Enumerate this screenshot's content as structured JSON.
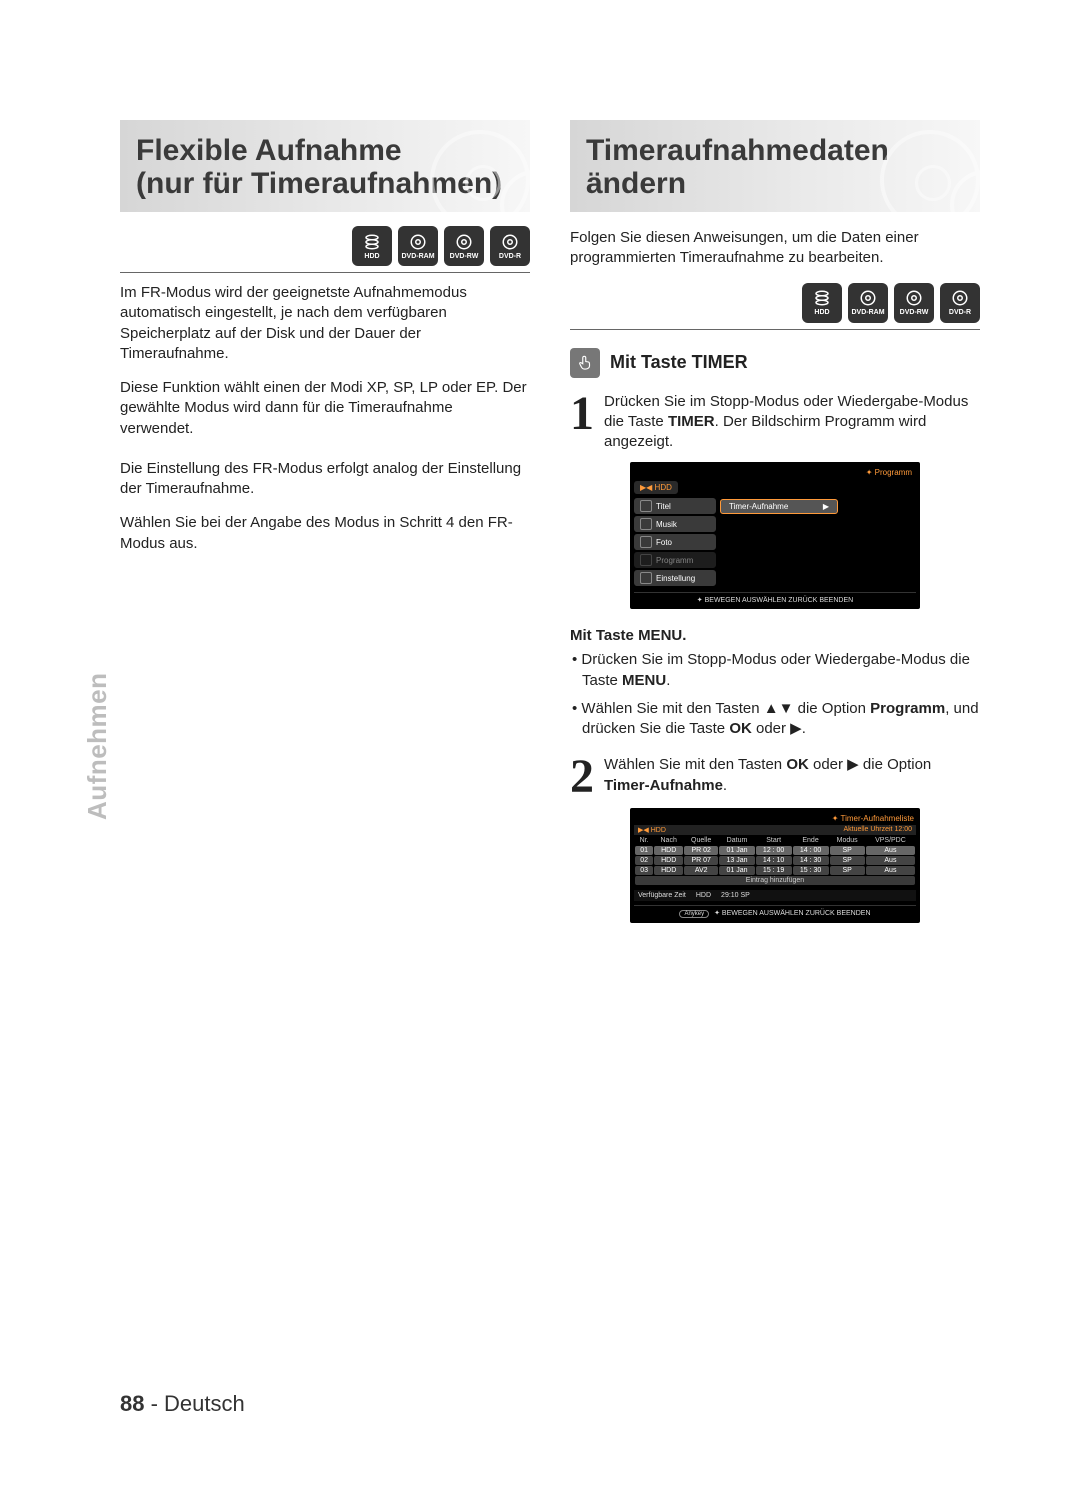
{
  "section_tab": "Aufnehmen",
  "footer": {
    "page": "88",
    "sep": " - ",
    "lang": "Deutsch"
  },
  "left": {
    "heading_l1": "Flexible Aufnahme",
    "heading_l2": "(nur für Timeraufnahmen)",
    "icons": [
      "HDD",
      "DVD-RAM",
      "DVD-RW",
      "DVD-R"
    ],
    "para1": "Im FR-Modus wird der geeignetste Aufnahmemodus automatisch eingestellt, je nach dem verfügbaren Speicherplatz auf der Disk und der Dauer der Timeraufnahme.",
    "para2": "Diese Funktion wählt einen der Modi XP, SP, LP oder EP. Der gewählte Modus wird dann für die Timeraufnahme verwendet.",
    "para3": "Die Einstellung des FR-Modus erfolgt analog der Einstellung der Timeraufnahme.",
    "para4": "Wählen Sie bei der Angabe des Modus in Schritt 4 den FR-Modus aus."
  },
  "right": {
    "heading_l1": "Timeraufnahmedaten",
    "heading_l2": "ändern",
    "intro": "Folgen Sie diesen Anweisungen, um die  Daten einer programmierten Timeraufnahme zu bearbeiten.",
    "icons": [
      "HDD",
      "DVD-RAM",
      "DVD-RW",
      "DVD-R"
    ],
    "subhead1": "Mit Taste TIMER",
    "step1_a": "Drücken Sie im Stopp-Modus oder Wiedergabe-Modus die Taste ",
    "step1_b": "TIMER",
    "step1_c": ". Der Bildschirm Programm wird angezeigt.",
    "menu_subhead": "Mit Taste MENU.",
    "bullet1_a": "Drücken Sie im Stopp-Modus oder Wiedergabe-Modus die Taste ",
    "bullet1_b": "MENU",
    "bullet1_c": ".",
    "bullet2_a": "Wählen Sie mit den Tasten ▲▼ die Option ",
    "bullet2_b": "Programm",
    "bullet2_c": ", und drücken Sie die Taste ",
    "bullet2_d": "OK",
    "bullet2_e": " oder ▶.",
    "step2_a": "Wählen Sie mit den Tasten ",
    "step2_b": "OK",
    "step2_c": " oder ▶ die Option ",
    "step2_d": "Timer-Aufnahme",
    "step2_e": "."
  },
  "scr1": {
    "title": "Programm",
    "path_icon": "▶◀",
    "path": "HDD",
    "items": [
      "Titel",
      "Musik",
      "Foto",
      "Programm",
      "Einstellung"
    ],
    "sel": "Timer-Aufnahme",
    "nav": "BEWEGEN   AUSWÄHLEN   ZURÜCK   BEENDEN"
  },
  "scr2": {
    "title": "Timer-Aufnahmeliste",
    "path_icon": "▶◀",
    "path": "HDD",
    "clock_label": "Aktuelle Uhrzeit",
    "clock": "12:00",
    "cols": [
      "Nr.",
      "Nach",
      "Quelle",
      "Datum",
      "Start",
      "Ende",
      "Modus",
      "VPS/PDC"
    ],
    "rows": [
      [
        "01",
        "HDD",
        "PR 02",
        "01 Jan",
        "12 : 00",
        "14 : 00",
        "SP",
        "Aus"
      ],
      [
        "02",
        "HDD",
        "PR 07",
        "13 Jan",
        "14 : 10",
        "14 : 30",
        "SP",
        "Aus"
      ],
      [
        "03",
        "HDD",
        "AV2",
        "01 Jan",
        "15 : 19",
        "15 : 30",
        "SP",
        "Aus"
      ]
    ],
    "addrow": "Eintrag hinzufügen",
    "avail_label": "Verfügbare Zeit",
    "avail_dev": "HDD",
    "avail_time": "29:10 SP",
    "anykey": "Anykey",
    "nav": "BEWEGEN   AUSWÄHLEN   ZURÜCK   BEENDEN"
  }
}
